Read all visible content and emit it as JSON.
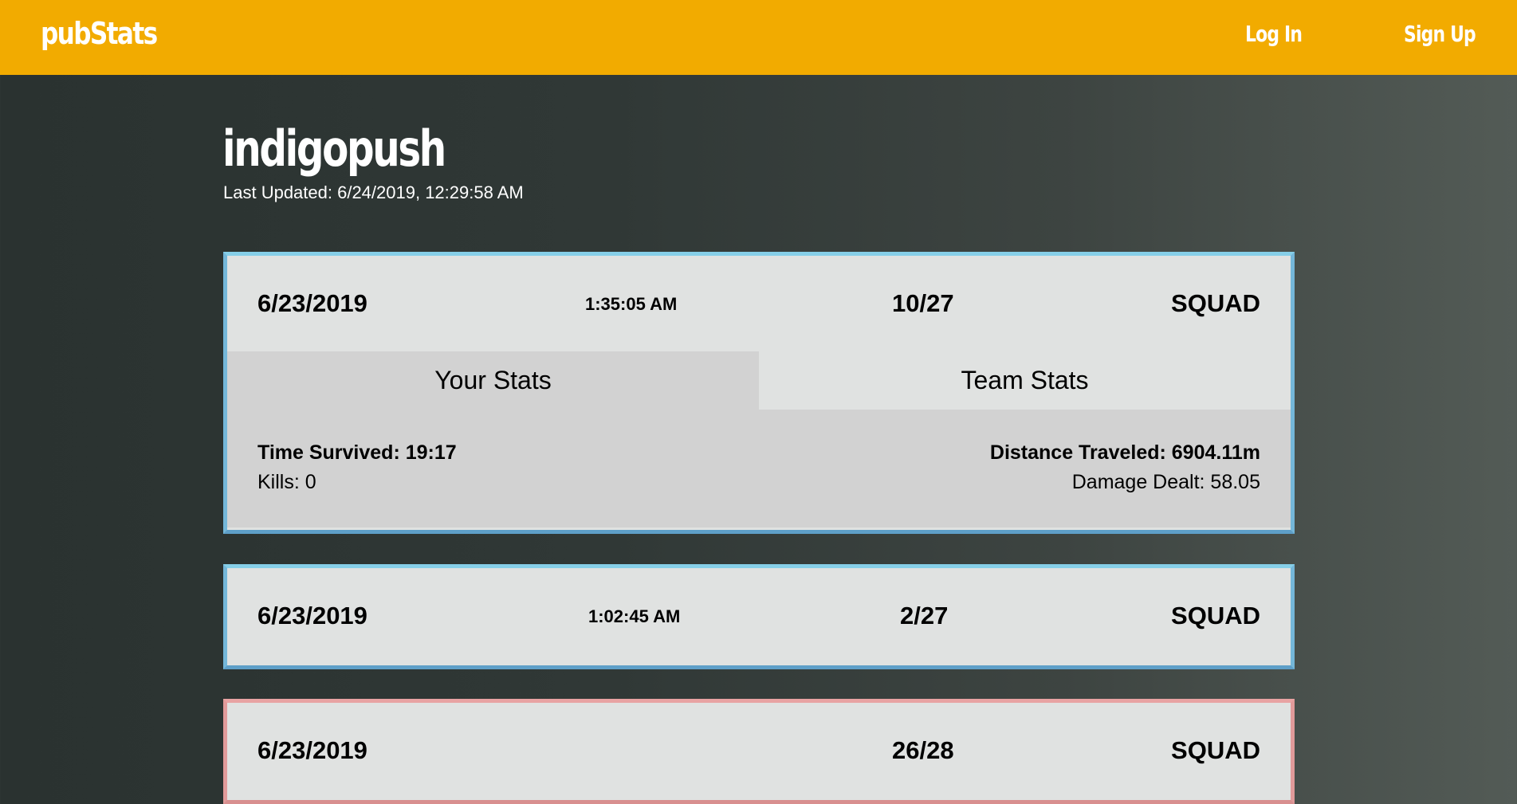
{
  "header": {
    "brand": "pubStats",
    "login_label": "Log In",
    "signup_label": "Sign Up",
    "bg_color": "#f2ab00"
  },
  "profile": {
    "name": "indigopush",
    "last_updated": "Last Updated: 6/24/2019, 12:29:58 AM"
  },
  "matches": [
    {
      "date": "6/23/2019",
      "time": "1:35:05 AM",
      "placement": "10/27",
      "mode": "SQUAD",
      "result_color": "#74b7d9",
      "expanded": true,
      "tabs": [
        "Your Stats",
        "Team Stats"
      ],
      "active_tab": "Your Stats",
      "stats": {
        "time_survived": "Time Survived: 19:17",
        "kills": "Kills: 0",
        "distance": "Distance Traveled: 6904.11m",
        "damage": "Damage Dealt: 58.05"
      }
    },
    {
      "date": "6/23/2019",
      "time": "1:02:45 AM",
      "placement": "2/27",
      "mode": "SQUAD",
      "result_color": "#74b7d9",
      "expanded": false
    },
    {
      "date": "6/23/2019",
      "time": "",
      "placement": "26/28",
      "mode": "SQUAD",
      "result_color": "#e19a9a",
      "expanded": false
    }
  ]
}
